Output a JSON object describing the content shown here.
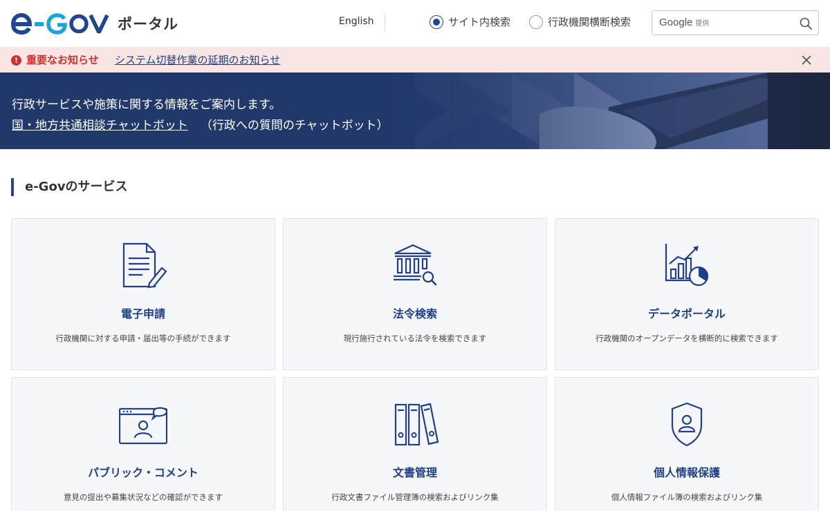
{
  "header": {
    "logo_text": "e-GOV",
    "logo_sub": "ポータル",
    "lang_link": "English",
    "search_scope": [
      {
        "label": "サイト内検索",
        "selected": true
      },
      {
        "label": "行政機関横断検索",
        "selected": false
      }
    ],
    "search_provider_brand": "Google",
    "search_provider_suffix": "提供"
  },
  "notice": {
    "label": "重要なお知らせ",
    "link": "システム切替作業の延期のお知らせ"
  },
  "banner": {
    "lead": "行政サービスや施策に関する情報をご案内します。",
    "chat_link": "国・地方共通相談チャットボット",
    "chat_note": "（行政への質問のチャットボット）"
  },
  "services": {
    "title": "e-Govのサービス",
    "items": [
      {
        "icon": "document-pen-icon",
        "title": "電子申請",
        "desc": "行政機関に対する申請・届出等の手続ができます"
      },
      {
        "icon": "court-search-icon",
        "title": "法令検索",
        "desc": "現行施行されている法令を検索できます"
      },
      {
        "icon": "chart-data-icon",
        "title": "データポータル",
        "desc": "行政機関のオープンデータを横断的に検索できます"
      },
      {
        "icon": "comment-window-icon",
        "title": "パブリック・コメント",
        "desc": "意見の提出や募集状況などの確認ができます"
      },
      {
        "icon": "binders-icon",
        "title": "文書管理",
        "desc": "行政文書ファイル管理簿の検索およびリンク集"
      },
      {
        "icon": "shield-person-icon",
        "title": "個人情報保護",
        "desc": "個人情報ファイル簿の検索およびリンク集"
      }
    ]
  },
  "colors": {
    "brand_navy": "#1f4593",
    "brand_cyan": "#1aa4d9",
    "notice_bg": "#f8e6e4",
    "notice_red": "#c8342c",
    "banner_bg": "#21386a",
    "card_bg": "#f5f7fb"
  }
}
